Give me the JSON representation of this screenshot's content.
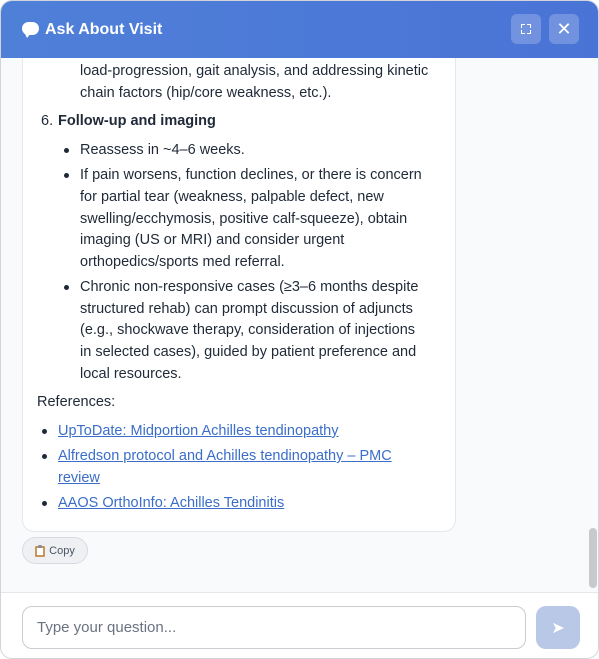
{
  "window": {
    "title": "Ask About Visit",
    "expand_label": "⛶",
    "close_label": "✕"
  },
  "message": {
    "continuation_line": "load-progression, gait analysis, and addressing kinetic",
    "continuation_line2": "chain factors (hip/core weakness, etc.).",
    "section6_number": "6.",
    "section6_title": "Follow-up and imaging",
    "bullets": [
      {
        "lines": [
          "Reassess in ~4–6 weeks."
        ]
      },
      {
        "lines": [
          "If pain worsens, function declines, or there is concern",
          "for partial tear (weakness, palpable defect, new",
          "swelling/ecchymosis, positive calf-squeeze), obtain",
          "imaging (US or MRI) and consider urgent",
          "orthopedics/sports med referral."
        ]
      },
      {
        "lines": [
          "Chronic non-responsive cases (≥3–6 months despite",
          "structured rehab) can prompt discussion of adjuncts",
          "(e.g., shockwave therapy, consideration of injections",
          "in selected cases), guided by patient preference and",
          "local resources."
        ]
      }
    ],
    "references_label": "References:",
    "references": [
      {
        "line1": "UpToDate: Midportion Achilles tendinopathy",
        "line2": ""
      },
      {
        "line1": "Alfredson protocol and Achilles tendinopathy – PMC",
        "line2": "review"
      },
      {
        "line1": "AAOS OrthoInfo: Achilles Tendinitis",
        "line2": ""
      }
    ]
  },
  "copy_button": {
    "label": "Copy",
    "icon": "clipboard-icon"
  },
  "composer": {
    "placeholder": "Type your question...",
    "send_icon": "send-icon",
    "send_label": "➤"
  },
  "colors": {
    "header": "#4a73d6",
    "link": "#3b6ec9",
    "send_button": "#b8c8e6"
  }
}
